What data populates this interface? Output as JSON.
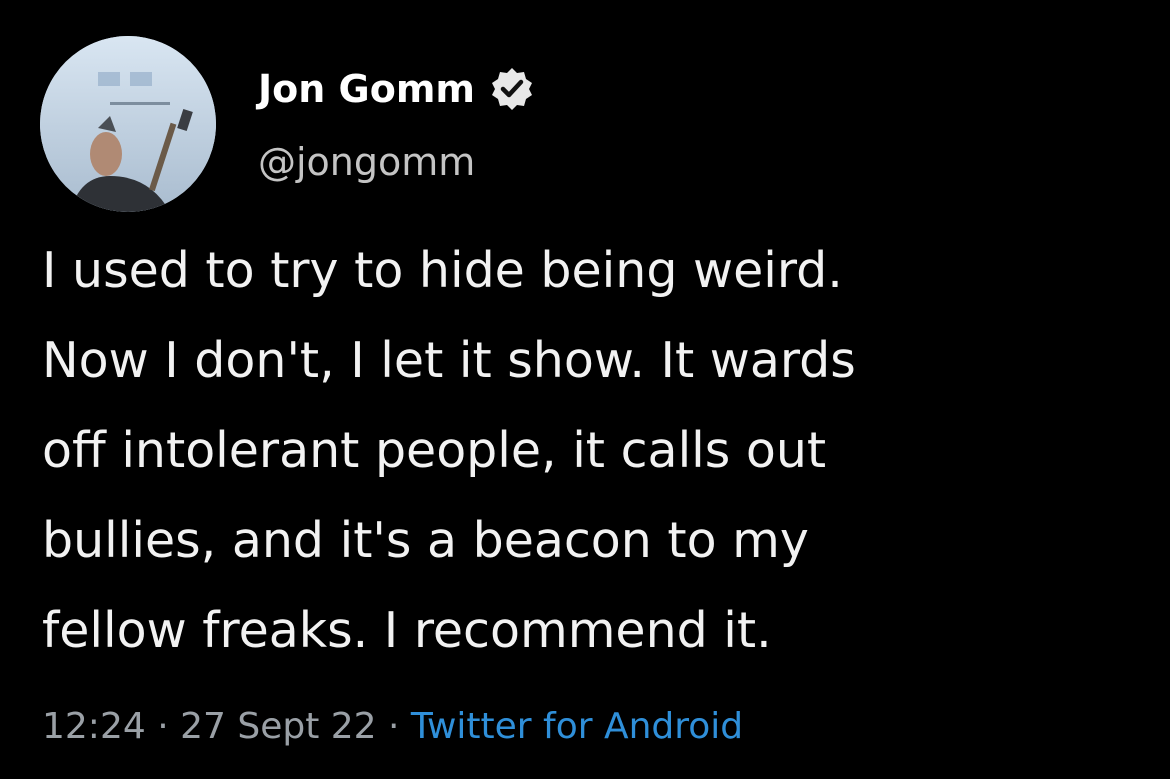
{
  "author": {
    "display_name": "Jon Gomm",
    "handle": "@jongomm",
    "verified": true,
    "avatar_icon": "avatar-photo-icon"
  },
  "tweet": {
    "lines": [
      "I used to try to hide being weird.",
      "Now I don't, I let it show. It wards",
      "off intolerant people, it calls out",
      "bullies, and it's a beacon to my",
      "fellow freaks. I recommend it."
    ]
  },
  "meta": {
    "time": "12:24",
    "separator_1": " · ",
    "date": "27 Sept 22",
    "separator_2": " · ",
    "source": "Twitter for Android"
  },
  "colors": {
    "background": "#000000",
    "text": "#f2f2f2",
    "muted": "#9aa0a6",
    "link": "#2f8fd9"
  }
}
